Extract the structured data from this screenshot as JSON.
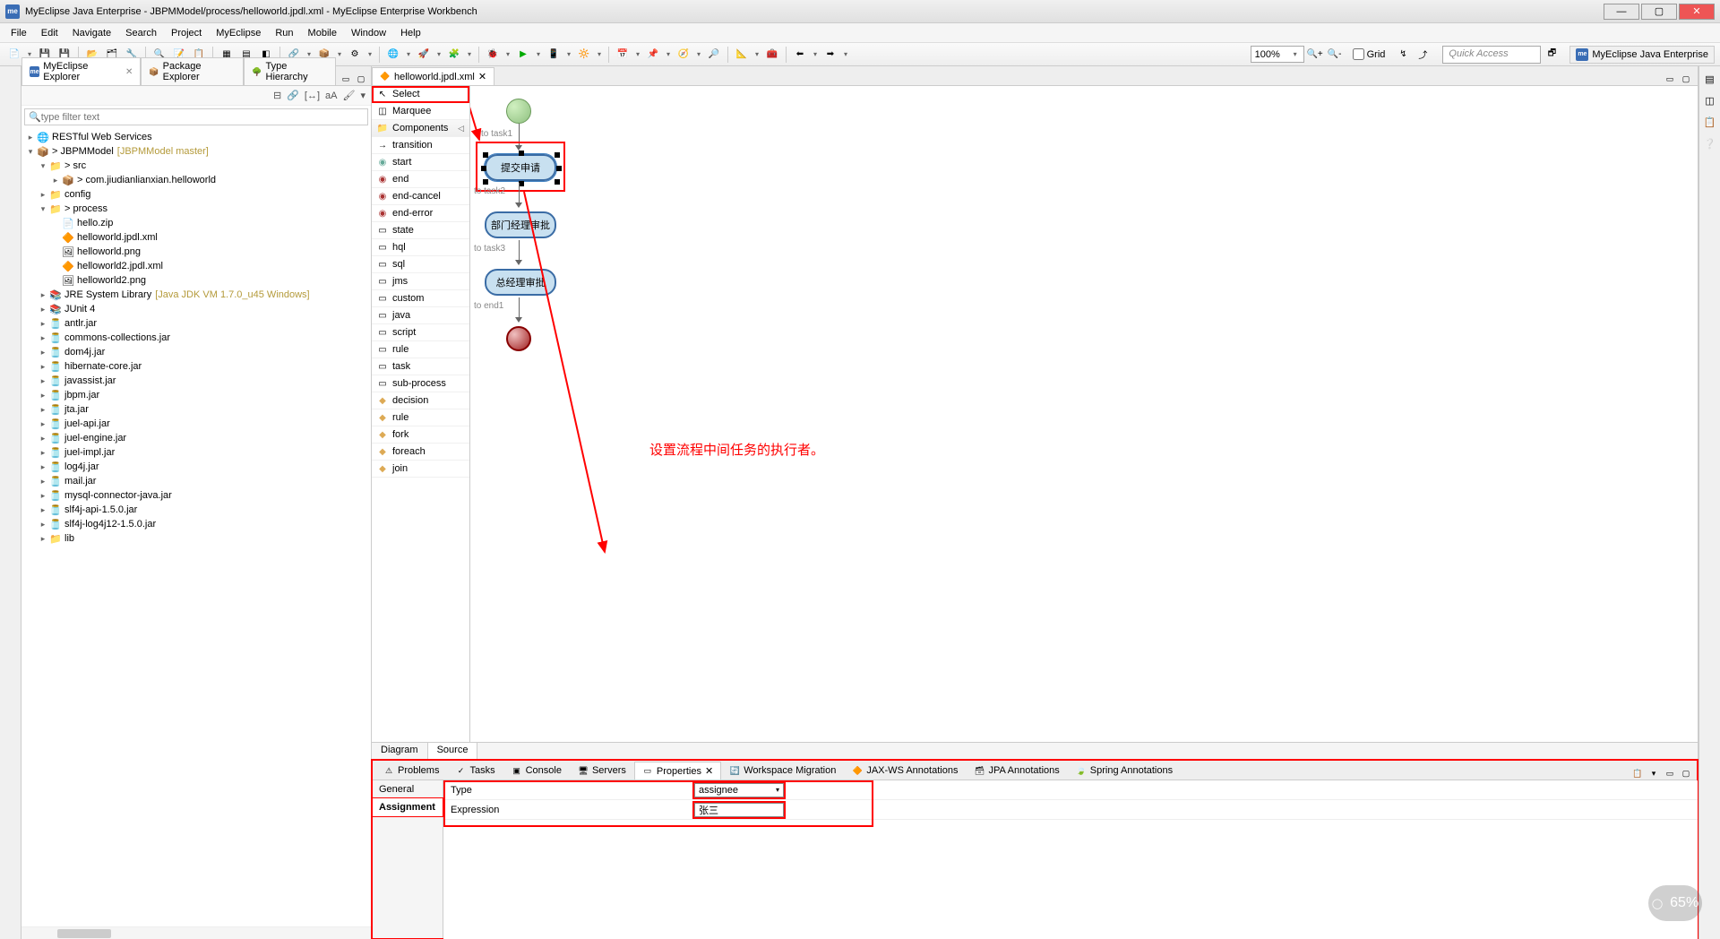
{
  "window": {
    "title": "MyEclipse Java Enterprise - JBPMModel/process/helloworld.jpdl.xml - MyEclipse Enterprise Workbench"
  },
  "menubar": [
    "File",
    "Edit",
    "Navigate",
    "Search",
    "Project",
    "MyEclipse",
    "Run",
    "Mobile",
    "Window",
    "Help"
  ],
  "zoom": "100%",
  "gridlabel": "Grid",
  "quickaccess": "Quick Access",
  "perspective": "MyEclipse Java Enterprise",
  "explorer": {
    "tabs": [
      "MyEclipse Explorer",
      "Package Explorer",
      "Type Hierarchy"
    ],
    "filter_ph": "type filter text",
    "tree": [
      {
        "lvl": 0,
        "tw": "▸",
        "ic": "🌐",
        "label": "RESTful Web Services"
      },
      {
        "lvl": 0,
        "tw": "▾",
        "ic": "📦",
        "label": "> JBPMModel",
        "hint": "[JBPMModel master]"
      },
      {
        "lvl": 1,
        "tw": "▾",
        "ic": "📁",
        "label": "> src"
      },
      {
        "lvl": 2,
        "tw": "▸",
        "ic": "📦",
        "label": "> com.jiudianlianxian.helloworld"
      },
      {
        "lvl": 1,
        "tw": "▸",
        "ic": "📁",
        "label": "config"
      },
      {
        "lvl": 1,
        "tw": "▾",
        "ic": "📁",
        "label": "> process"
      },
      {
        "lvl": 2,
        "tw": "",
        "ic": "📄",
        "label": "hello.zip"
      },
      {
        "lvl": 2,
        "tw": "",
        "ic": "🔶",
        "label": "helloworld.jpdl.xml"
      },
      {
        "lvl": 2,
        "tw": "",
        "ic": "🖼",
        "label": "helloworld.png"
      },
      {
        "lvl": 2,
        "tw": "",
        "ic": "🔶",
        "label": "helloworld2.jpdl.xml"
      },
      {
        "lvl": 2,
        "tw": "",
        "ic": "🖼",
        "label": "helloworld2.png"
      },
      {
        "lvl": 1,
        "tw": "▸",
        "ic": "📚",
        "label": "JRE System Library",
        "hint": "[Java JDK VM 1.7.0_u45 Windows]"
      },
      {
        "lvl": 1,
        "tw": "▸",
        "ic": "📚",
        "label": "JUnit 4"
      },
      {
        "lvl": 1,
        "tw": "▸",
        "ic": "🫙",
        "label": "antlr.jar"
      },
      {
        "lvl": 1,
        "tw": "▸",
        "ic": "🫙",
        "label": "commons-collections.jar"
      },
      {
        "lvl": 1,
        "tw": "▸",
        "ic": "🫙",
        "label": "dom4j.jar"
      },
      {
        "lvl": 1,
        "tw": "▸",
        "ic": "🫙",
        "label": "hibernate-core.jar"
      },
      {
        "lvl": 1,
        "tw": "▸",
        "ic": "🫙",
        "label": "javassist.jar"
      },
      {
        "lvl": 1,
        "tw": "▸",
        "ic": "🫙",
        "label": "jbpm.jar"
      },
      {
        "lvl": 1,
        "tw": "▸",
        "ic": "🫙",
        "label": "jta.jar"
      },
      {
        "lvl": 1,
        "tw": "▸",
        "ic": "🫙",
        "label": "juel-api.jar"
      },
      {
        "lvl": 1,
        "tw": "▸",
        "ic": "🫙",
        "label": "juel-engine.jar"
      },
      {
        "lvl": 1,
        "tw": "▸",
        "ic": "🫙",
        "label": "juel-impl.jar"
      },
      {
        "lvl": 1,
        "tw": "▸",
        "ic": "🫙",
        "label": "log4j.jar"
      },
      {
        "lvl": 1,
        "tw": "▸",
        "ic": "🫙",
        "label": "mail.jar"
      },
      {
        "lvl": 1,
        "tw": "▸",
        "ic": "🫙",
        "label": "mysql-connector-java.jar"
      },
      {
        "lvl": 1,
        "tw": "▸",
        "ic": "🫙",
        "label": "slf4j-api-1.5.0.jar"
      },
      {
        "lvl": 1,
        "tw": "▸",
        "ic": "🫙",
        "label": "slf4j-log4j12-1.5.0.jar"
      },
      {
        "lvl": 1,
        "tw": "▸",
        "ic": "📁",
        "label": "lib"
      }
    ]
  },
  "editor": {
    "tab": "helloworld.jpdl.xml",
    "palette": [
      {
        "ic": "↖",
        "label": "Select",
        "selected": true
      },
      {
        "ic": "◫",
        "label": "Marquee"
      },
      {
        "ic": "📁",
        "label": "Components",
        "header": true,
        "arrow": "◁"
      },
      {
        "ic": "→",
        "label": "transition"
      },
      {
        "ic": "◉",
        "label": "start",
        "color": "#6a9"
      },
      {
        "ic": "◉",
        "label": "end",
        "color": "#a33"
      },
      {
        "ic": "◉",
        "label": "end-cancel",
        "color": "#a33"
      },
      {
        "ic": "◉",
        "label": "end-error",
        "color": "#a33"
      },
      {
        "ic": "▭",
        "label": "state"
      },
      {
        "ic": "▭",
        "label": "hql"
      },
      {
        "ic": "▭",
        "label": "sql"
      },
      {
        "ic": "▭",
        "label": "jms"
      },
      {
        "ic": "▭",
        "label": "custom"
      },
      {
        "ic": "▭",
        "label": "java"
      },
      {
        "ic": "▭",
        "label": "script"
      },
      {
        "ic": "▭",
        "label": "rule"
      },
      {
        "ic": "▭",
        "label": "task"
      },
      {
        "ic": "▭",
        "label": "sub-process"
      },
      {
        "ic": "◆",
        "label": "decision",
        "color": "#da5"
      },
      {
        "ic": "◆",
        "label": "rule",
        "color": "#da5"
      },
      {
        "ic": "◆",
        "label": "fork",
        "color": "#da5"
      },
      {
        "ic": "◆",
        "label": "foreach",
        "color": "#da5"
      },
      {
        "ic": "◆",
        "label": "join",
        "color": "#da5"
      }
    ],
    "nodes": {
      "task1_label": "提交申请",
      "task2_label": "部门经理审批",
      "task3_label": "总经理审批",
      "edge1": "to task1",
      "edge2": "to task2",
      "edge3": "to task3",
      "edge4": "to end1"
    },
    "diagramtabs": [
      "Diagram",
      "Source"
    ],
    "annotation": "设置流程中间任务的执行者。"
  },
  "bottom": {
    "tabs": [
      "Problems",
      "Tasks",
      "Console",
      "Servers",
      "Properties",
      "Workspace Migration",
      "JAX-WS Annotations",
      "JPA Annotations",
      "Spring Annotations"
    ],
    "activeTab": 4,
    "side": [
      "General",
      "Assignment"
    ],
    "activeSide": 1,
    "form": {
      "type_label": "Type",
      "type_value": "assignee",
      "expr_label": "Expression",
      "expr_value": "张三"
    }
  },
  "badge": "65%"
}
